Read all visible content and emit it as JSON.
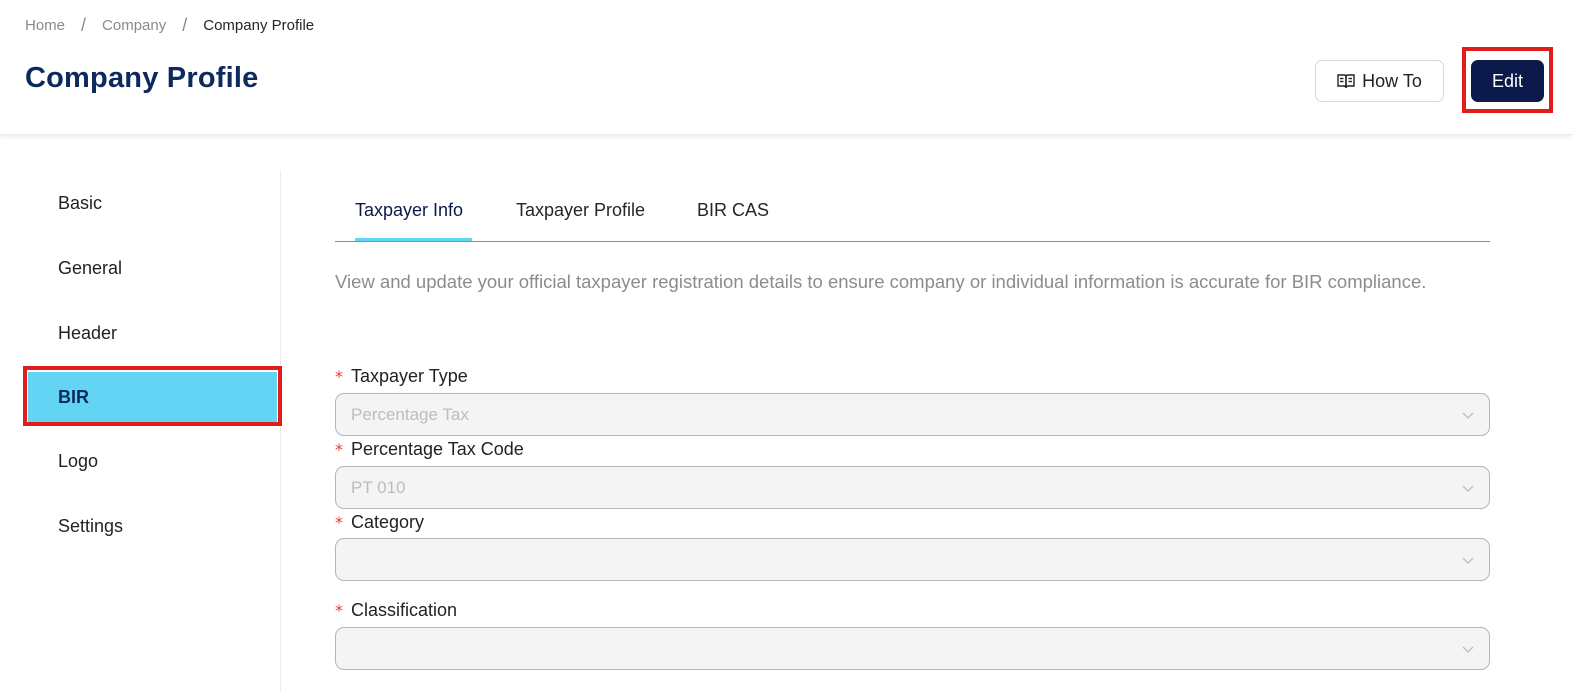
{
  "breadcrumb": {
    "items": [
      "Home",
      "Company",
      "Company Profile"
    ],
    "separator": "/"
  },
  "header": {
    "title": "Company Profile",
    "how_to_label": "How To",
    "edit_label": "Edit"
  },
  "sidebar": {
    "items": [
      {
        "label": "Basic"
      },
      {
        "label": "General"
      },
      {
        "label": "Header"
      },
      {
        "label": "BIR",
        "active": true
      },
      {
        "label": "Logo"
      },
      {
        "label": "Settings"
      }
    ]
  },
  "tabs": [
    {
      "label": "Taxpayer Info",
      "active": true
    },
    {
      "label": "Taxpayer Profile"
    },
    {
      "label": "BIR CAS"
    }
  ],
  "description": "View and update your official taxpayer registration details to ensure company or individual information is accurate for BIR compliance.",
  "form": {
    "required_mark": "*",
    "taxpayer_type": {
      "label": "Taxpayer Type",
      "value": "Percentage Tax"
    },
    "percentage_tax_code": {
      "label": "Percentage Tax Code",
      "value": "PT 010"
    },
    "category": {
      "label": "Category",
      "value": ""
    },
    "classification": {
      "label": "Classification",
      "value": ""
    }
  },
  "colors": {
    "accent": "#64d4f4",
    "primary_dark": "#0b1a4a",
    "title": "#0d2a5c",
    "highlight": "#e21d1d",
    "required": "#e23b3b"
  },
  "icons": {
    "how_to": "book-icon",
    "select": "chevron-down-icon"
  }
}
